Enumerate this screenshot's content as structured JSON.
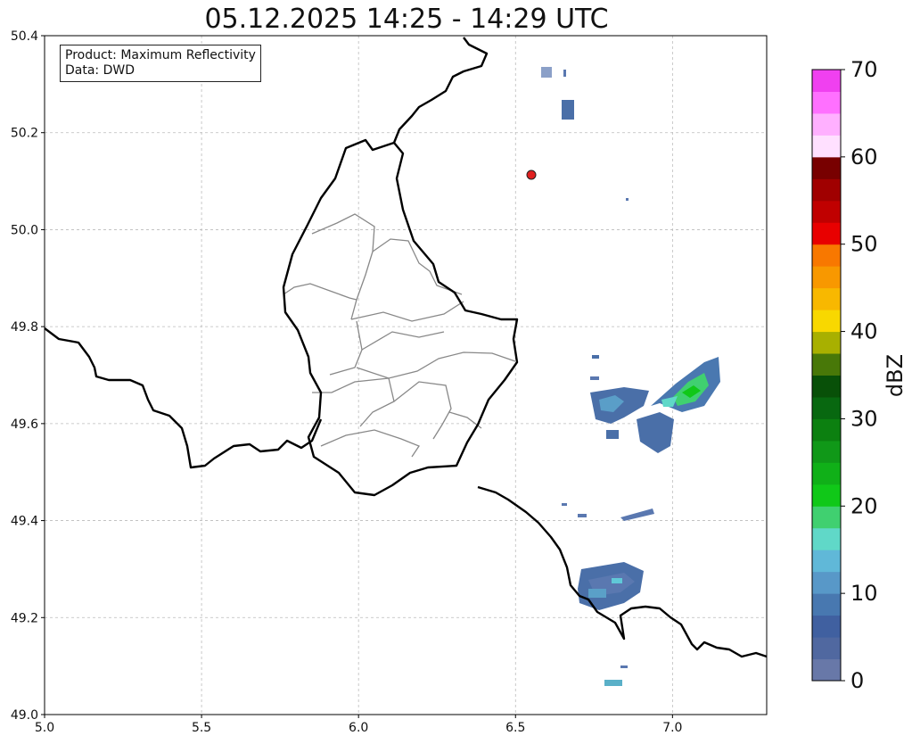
{
  "title": "05.12.2025 14:25 - 14:29 UTC",
  "info": {
    "product": "Product: Maximum Reflectivity",
    "data": "Data: DWD"
  },
  "axes": {
    "x_ticks": [
      "5.0",
      "5.5",
      "6.0",
      "6.5",
      "7.0"
    ],
    "y_ticks": [
      "49.0",
      "49.2",
      "49.4",
      "49.6",
      "49.8",
      "50.0",
      "50.2",
      "50.4"
    ],
    "lon_range": [
      5.0,
      7.3
    ],
    "lat_range": [
      49.0,
      50.4
    ],
    "grid": "on"
  },
  "colorbar": {
    "label": "dBZ",
    "ticks": [
      "0",
      "10",
      "20",
      "30",
      "40",
      "50",
      "60",
      "70"
    ],
    "range": [
      0,
      70
    ],
    "colors": [
      "#6878a8",
      "#5068a0",
      "#4060a0",
      "#4878b0",
      "#5898c8",
      "#60b8d8",
      "#60d8c8",
      "#40d070",
      "#10c818",
      "#10b018",
      "#109818",
      "#0c8010",
      "#086810",
      "#085008",
      "#487808",
      "#a8b000",
      "#f8d800",
      "#f8b800",
      "#f89800",
      "#f87800",
      "#e80000",
      "#c00000",
      "#a00000",
      "#780000",
      "#ffe0ff",
      "#ffb0ff",
      "#ff70ff",
      "#f040f0"
    ]
  },
  "marker": {
    "lon": 6.54,
    "lat": 50.11,
    "color": "#e02020"
  }
}
